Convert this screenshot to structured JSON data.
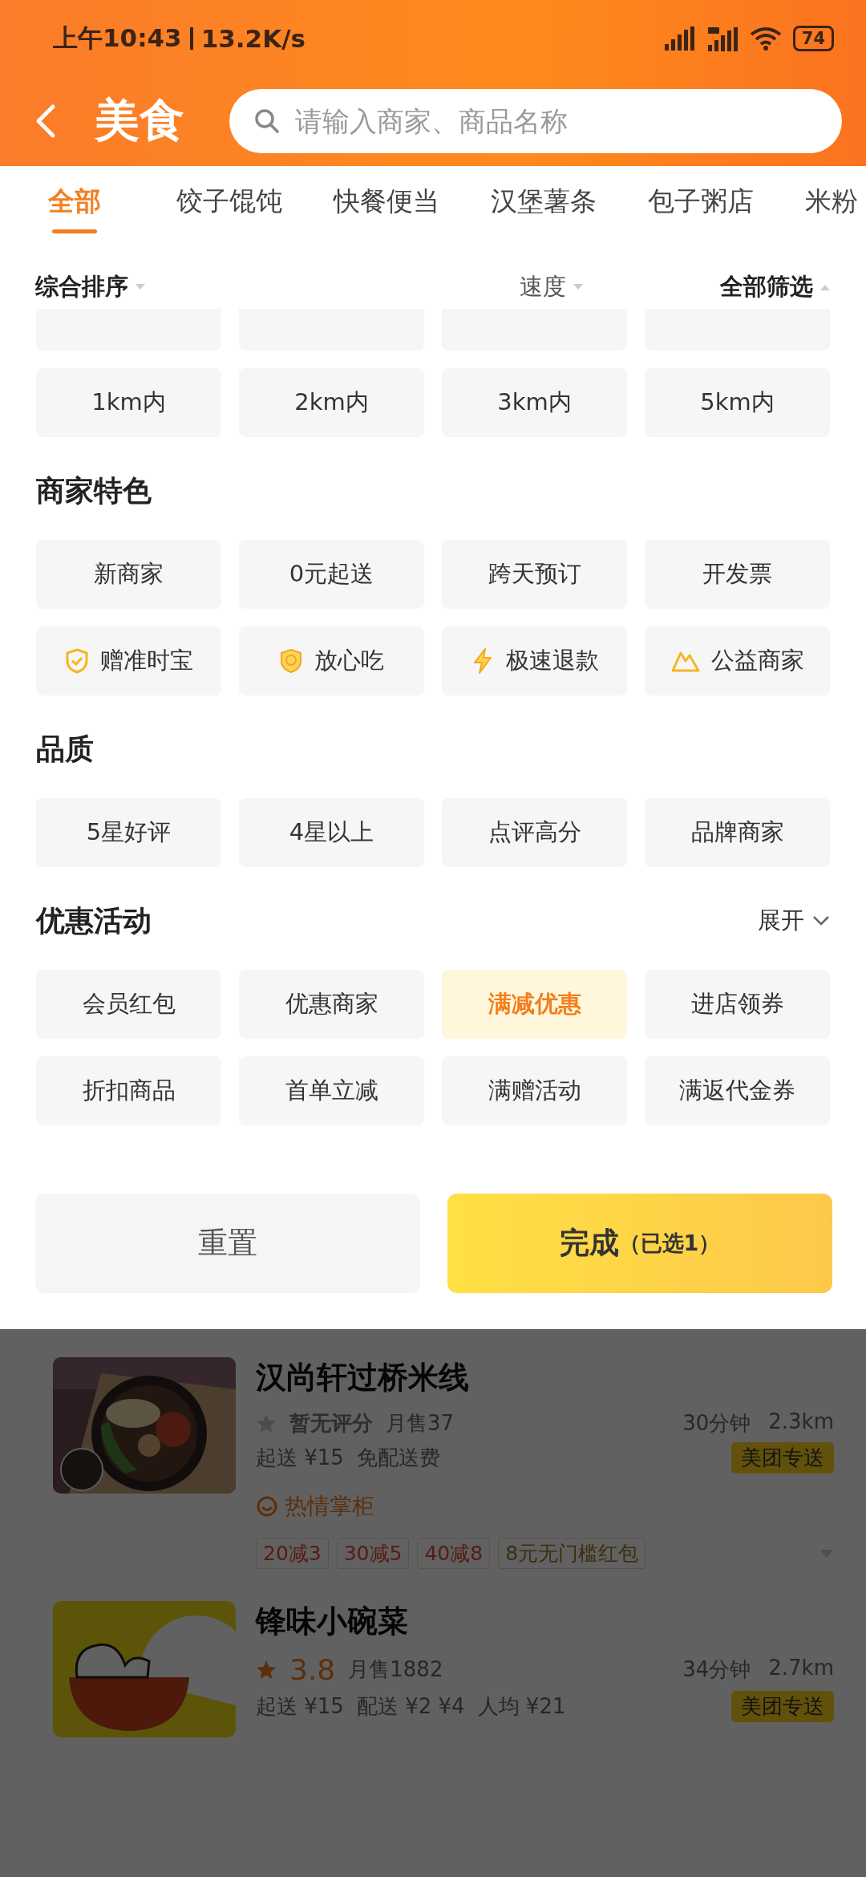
{
  "status_bar": {
    "time": "上午10:43",
    "speed": "13.2K/s",
    "battery": "74"
  },
  "header": {
    "title": "美食",
    "search": {
      "placeholder": "请输入商家、商品名称"
    }
  },
  "category_tabs": [
    {
      "label": "全部",
      "selected": true
    },
    {
      "label": "饺子馄饨",
      "selected": false
    },
    {
      "label": "快餐便当",
      "selected": false
    },
    {
      "label": "汉堡薯条",
      "selected": false
    },
    {
      "label": "包子粥店",
      "selected": false
    },
    {
      "label": "米粉",
      "selected": false
    }
  ],
  "sort_bar": [
    {
      "label": "综合排序",
      "active": true,
      "expanded": false
    },
    {
      "label": "速度",
      "active": false,
      "expanded": false
    },
    {
      "label": "全部筛选",
      "active": true,
      "expanded": true
    }
  ],
  "filter_sections": [
    {
      "partly_scrolled": true,
      "chips": [
        {
          "label": "1km内",
          "selected": false
        },
        {
          "label": "2km内",
          "selected": false
        },
        {
          "label": "3km内",
          "selected": false
        },
        {
          "label": "5km内",
          "selected": false
        }
      ]
    },
    {
      "title": "商家特色",
      "chips": [
        {
          "label": "新商家",
          "selected": false
        },
        {
          "label": "0元起送",
          "selected": false
        },
        {
          "label": "跨天预订",
          "selected": false
        },
        {
          "label": "开发票",
          "selected": false
        },
        {
          "label": "赠准时宝",
          "selected": false,
          "kind": "ontime"
        },
        {
          "label": "放心吃",
          "selected": false,
          "kind": "assured"
        },
        {
          "label": "极速退款",
          "selected": false,
          "kind": "refund"
        },
        {
          "label": "公益商家",
          "selected": false,
          "kind": "charity"
        }
      ]
    },
    {
      "title": "品质",
      "chips": [
        {
          "label": "5星好评",
          "selected": false
        },
        {
          "label": "4星以上",
          "selected": false
        },
        {
          "label": "点评高分",
          "selected": false
        },
        {
          "label": "品牌商家",
          "selected": false
        }
      ]
    },
    {
      "title": "优惠活动",
      "action": "展开",
      "chips": [
        {
          "label": "会员红包",
          "selected": false
        },
        {
          "label": "优惠商家",
          "selected": false
        },
        {
          "label": "满减优惠",
          "selected": true
        },
        {
          "label": "进店领券",
          "selected": false
        },
        {
          "label": "折扣商品",
          "selected": false
        },
        {
          "label": "首单立减",
          "selected": false
        },
        {
          "label": "满赠活动",
          "selected": false
        },
        {
          "label": "满返代金券",
          "selected": false
        }
      ]
    }
  ],
  "footer_buttons": {
    "reset": "重置",
    "done": "完成",
    "done_note": "（已选1）"
  },
  "restaurants": [
    {
      "name": "汉尚轩过桥米线",
      "kind": "picture",
      "rated": false,
      "rating": "暂无评分",
      "sales": "月售37",
      "time": "30分钟",
      "distance": "2.3km",
      "fees": [
        "起送 ¥15",
        "免配送费"
      ],
      "badge": "美团专送",
      "tag": "热情掌柜",
      "discounts": [
        {
          "label": "20减3",
          "kind": "cut"
        },
        {
          "label": "30减5",
          "kind": "cut"
        },
        {
          "label": "40减8",
          "kind": "cut"
        },
        {
          "label": "8元无门槛红包",
          "kind": "coupon"
        }
      ]
    },
    {
      "name": "锋味小碗菜",
      "kind": "logo",
      "rated": true,
      "rating": "3.8",
      "sales": "月售1882",
      "time": "34分钟",
      "distance": "2.7km",
      "fees": [
        "起送 ¥15",
        "配送 ¥2 ¥4",
        "人均 ¥21"
      ],
      "badge": "美团专送"
    }
  ]
}
